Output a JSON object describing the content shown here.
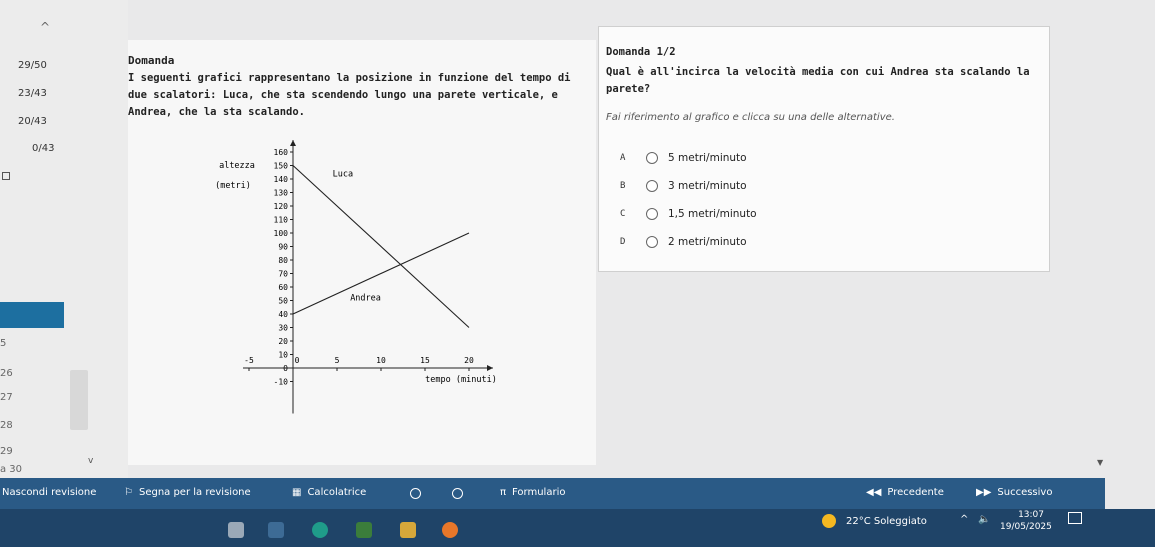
{
  "nav": {
    "top_chevron": "^",
    "counters": [
      "29/50",
      "23/43",
      "20/43",
      "0/43"
    ],
    "section_numbers": [
      "5",
      "26",
      "27",
      "28",
      "29",
      "a 30"
    ],
    "down_chevron": "v"
  },
  "question": {
    "title": "Domanda",
    "text": "I seguenti grafici rappresentano la posizione in funzione del tempo di due scalatori: Luca, che sta scendendo lungo una parete verticale, e Andrea, che la sta scalando."
  },
  "chart_data": {
    "type": "line",
    "ylabel": "altezza (metri)",
    "xlabel": "tempo (minuti)",
    "xlim": [
      -5,
      20
    ],
    "ylim": [
      -10,
      160
    ],
    "x_ticks": [
      -5,
      0,
      5,
      10,
      15,
      20
    ],
    "y_ticks": [
      -10,
      0,
      10,
      20,
      30,
      40,
      50,
      60,
      70,
      80,
      90,
      100,
      110,
      120,
      130,
      140,
      150,
      160
    ],
    "series": [
      {
        "name": "Luca",
        "points": [
          [
            0,
            150
          ],
          [
            20,
            30
          ]
        ]
      },
      {
        "name": "Andrea",
        "points": [
          [
            0,
            40
          ],
          [
            20,
            100
          ]
        ]
      }
    ]
  },
  "answer": {
    "title": "Domanda 1/2",
    "question": "Qual è all'incirca la velocità media con cui Andrea sta scalando la parete?",
    "hint": "Fai riferimento al grafico e clicca su una delle alternative.",
    "options": [
      {
        "letter": "A",
        "text": "5 metri/minuto"
      },
      {
        "letter": "B",
        "text": "3 metri/minuto"
      },
      {
        "letter": "C",
        "text": "1,5 metri/minuto"
      },
      {
        "letter": "D",
        "text": "2 metri/minuto"
      }
    ]
  },
  "footer": {
    "hide_review": "Nascondi revisione",
    "flag_review": "Segna per la revisione",
    "calculator": "Calcolatrice",
    "formulas": "Formulario",
    "pi_symbol": "π",
    "prev": "Precedente",
    "next": "Successivo"
  },
  "taskbar": {
    "weather": "22°C Soleggiato",
    "time": "13:07",
    "date": "19/05/2025"
  }
}
